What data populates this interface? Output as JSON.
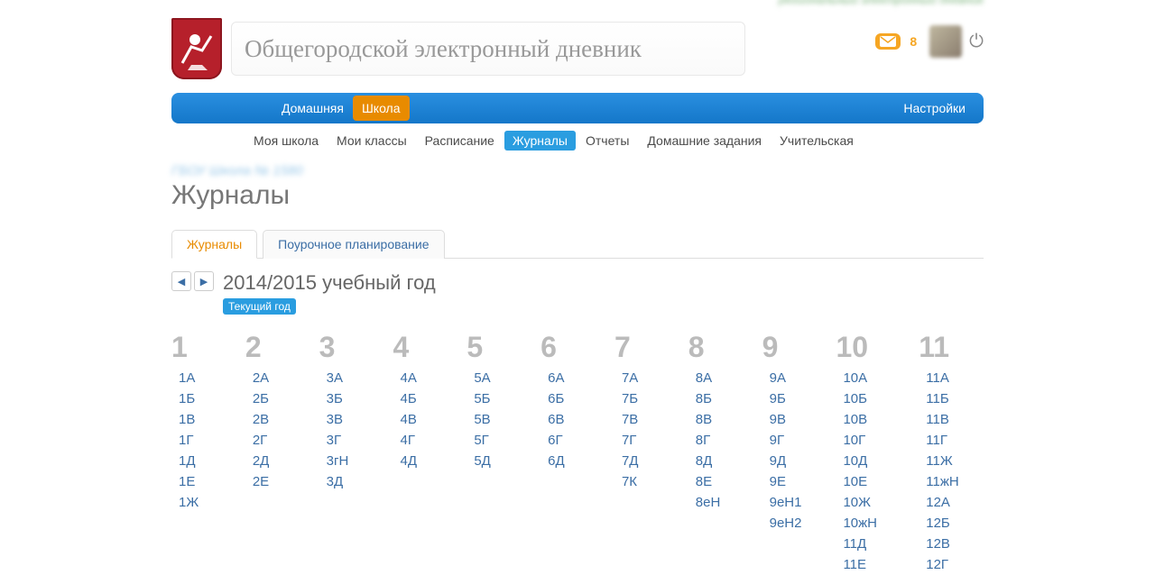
{
  "header": {
    "title": "Общегородской электронный дневник",
    "mail_count": "8"
  },
  "nav": {
    "items": [
      "Домашняя",
      "Школа"
    ],
    "active_index": 1,
    "right": "Настройки"
  },
  "subnav": {
    "items": [
      "Моя школа",
      "Мои классы",
      "Расписание",
      "Журналы",
      "Отчеты",
      "Домашние задания",
      "Учительская"
    ],
    "active_index": 3
  },
  "page_title": "Журналы",
  "tabs": {
    "items": [
      "Журналы",
      "Поурочное планирование"
    ],
    "active_index": 0
  },
  "year": {
    "label": "2014/2015 учебный год",
    "badge": "Текущий год"
  },
  "grades": [
    {
      "n": "1",
      "classes": [
        "1А",
        "1Б",
        "1В",
        "1Г",
        "1Д",
        "1Е",
        "1Ж"
      ]
    },
    {
      "n": "2",
      "classes": [
        "2А",
        "2Б",
        "2В",
        "2Г",
        "2Д",
        "2Е"
      ]
    },
    {
      "n": "3",
      "classes": [
        "3А",
        "3Б",
        "3В",
        "3Г",
        "3гН",
        "3Д"
      ]
    },
    {
      "n": "4",
      "classes": [
        "4А",
        "4Б",
        "4В",
        "4Г",
        "4Д"
      ]
    },
    {
      "n": "5",
      "classes": [
        "5А",
        "5Б",
        "5В",
        "5Г",
        "5Д"
      ]
    },
    {
      "n": "6",
      "classes": [
        "6А",
        "6Б",
        "6В",
        "6Г",
        "6Д"
      ]
    },
    {
      "n": "7",
      "classes": [
        "7А",
        "7Б",
        "7В",
        "7Г",
        "7Д",
        "7К"
      ]
    },
    {
      "n": "8",
      "classes": [
        "8А",
        "8Б",
        "8В",
        "8Г",
        "8Д",
        "8Е",
        "8еН"
      ]
    },
    {
      "n": "9",
      "classes": [
        "9А",
        "9Б",
        "9В",
        "9Г",
        "9Д",
        "9Е",
        "9еН1",
        "9еН2"
      ]
    },
    {
      "n": "10",
      "classes": [
        "10А",
        "10Б",
        "10В",
        "10Г",
        "10Д",
        "10Е",
        "10Ж",
        "10жН",
        "11Д",
        "11Е"
      ]
    },
    {
      "n": "11",
      "classes": [
        "11А",
        "11Б",
        "11В",
        "11Г",
        "11Ж",
        "11жН",
        "12А",
        "12Б",
        "12В",
        "12Г"
      ]
    }
  ]
}
